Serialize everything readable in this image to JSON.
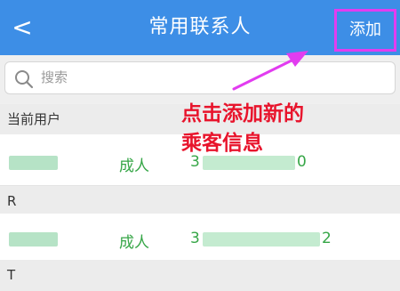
{
  "header": {
    "back_label": "<",
    "title": "常用联系人",
    "add_label": "添加"
  },
  "search": {
    "placeholder": "搜索"
  },
  "sections": [
    {
      "title": "当前用户",
      "contacts": [
        {
          "type": "成人",
          "phone_first": "3",
          "phone_last": "0"
        }
      ]
    },
    {
      "title": "R",
      "contacts": [
        {
          "type": "成人",
          "phone_first": "3",
          "phone_last": "2"
        }
      ]
    },
    {
      "title": "T",
      "contacts": []
    }
  ],
  "annotation": {
    "line1": "点击添加新的",
    "line2": "乘客信息",
    "color": "#e8142c",
    "arrow_color": "#e23cf0"
  },
  "colors": {
    "header_bg": "#3d8ee6",
    "contact_text": "#36a647"
  }
}
